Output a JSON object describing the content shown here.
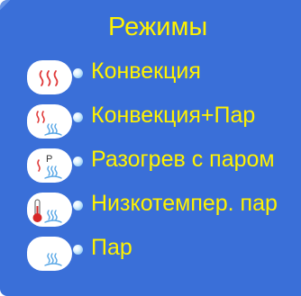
{
  "screen": {
    "title": "Режимы",
    "bg_color": "#3a6fd8",
    "text_color": "#fff200"
  },
  "modes": [
    {
      "label": "Конвекция",
      "icon": "convection-icon"
    },
    {
      "label": "Конвекция+Пар",
      "icon": "convection-steam-icon"
    },
    {
      "label": "Разогрев с паром",
      "icon": "preheat-steam-icon",
      "icon_text": "P"
    },
    {
      "label": "Низкотемпер. пар",
      "icon": "low-temp-steam-icon"
    },
    {
      "label": "Пар",
      "icon": "steam-icon"
    }
  ]
}
